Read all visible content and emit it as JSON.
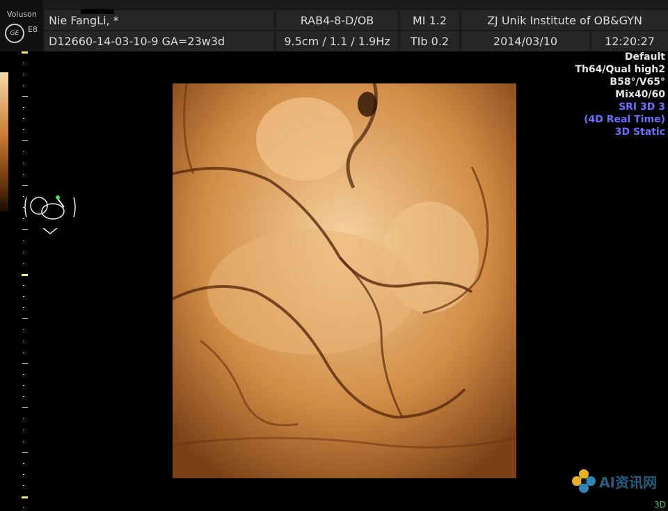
{
  "header": {
    "brand": "Voluson",
    "model": "E8",
    "logo_text": "GE",
    "patient_name": "Nie FangLi,  *",
    "patient_id": "D12660-14-03-10-9  GA=23w3d",
    "probe": "RAB4-8-D/OB",
    "acquisition": "9.5cm / 1.1 / 1.9Hz",
    "mi": "MI  1.2",
    "tib": "TIb  0.2",
    "institute": "ZJ Unik Institute of OB&GYN",
    "date": "2014/03/10",
    "time": "12:20:27"
  },
  "render_params": {
    "lines": [
      "Default",
      "Th64/Qual high2",
      "B58°/V65°",
      "Mix40/60"
    ],
    "modes": [
      "SRI 3D 3",
      "(4D Real Time)",
      "3D Static"
    ],
    "colors": {
      "white": "#e6e6e6",
      "blue": "#6b70ff"
    }
  },
  "watermark": {
    "text": "AI资讯网"
  },
  "mode_indicator": "3D",
  "colors": {
    "header_bg": "#262626",
    "tick_yellow": "#ffea63",
    "mode_green": "#3cc84a"
  }
}
